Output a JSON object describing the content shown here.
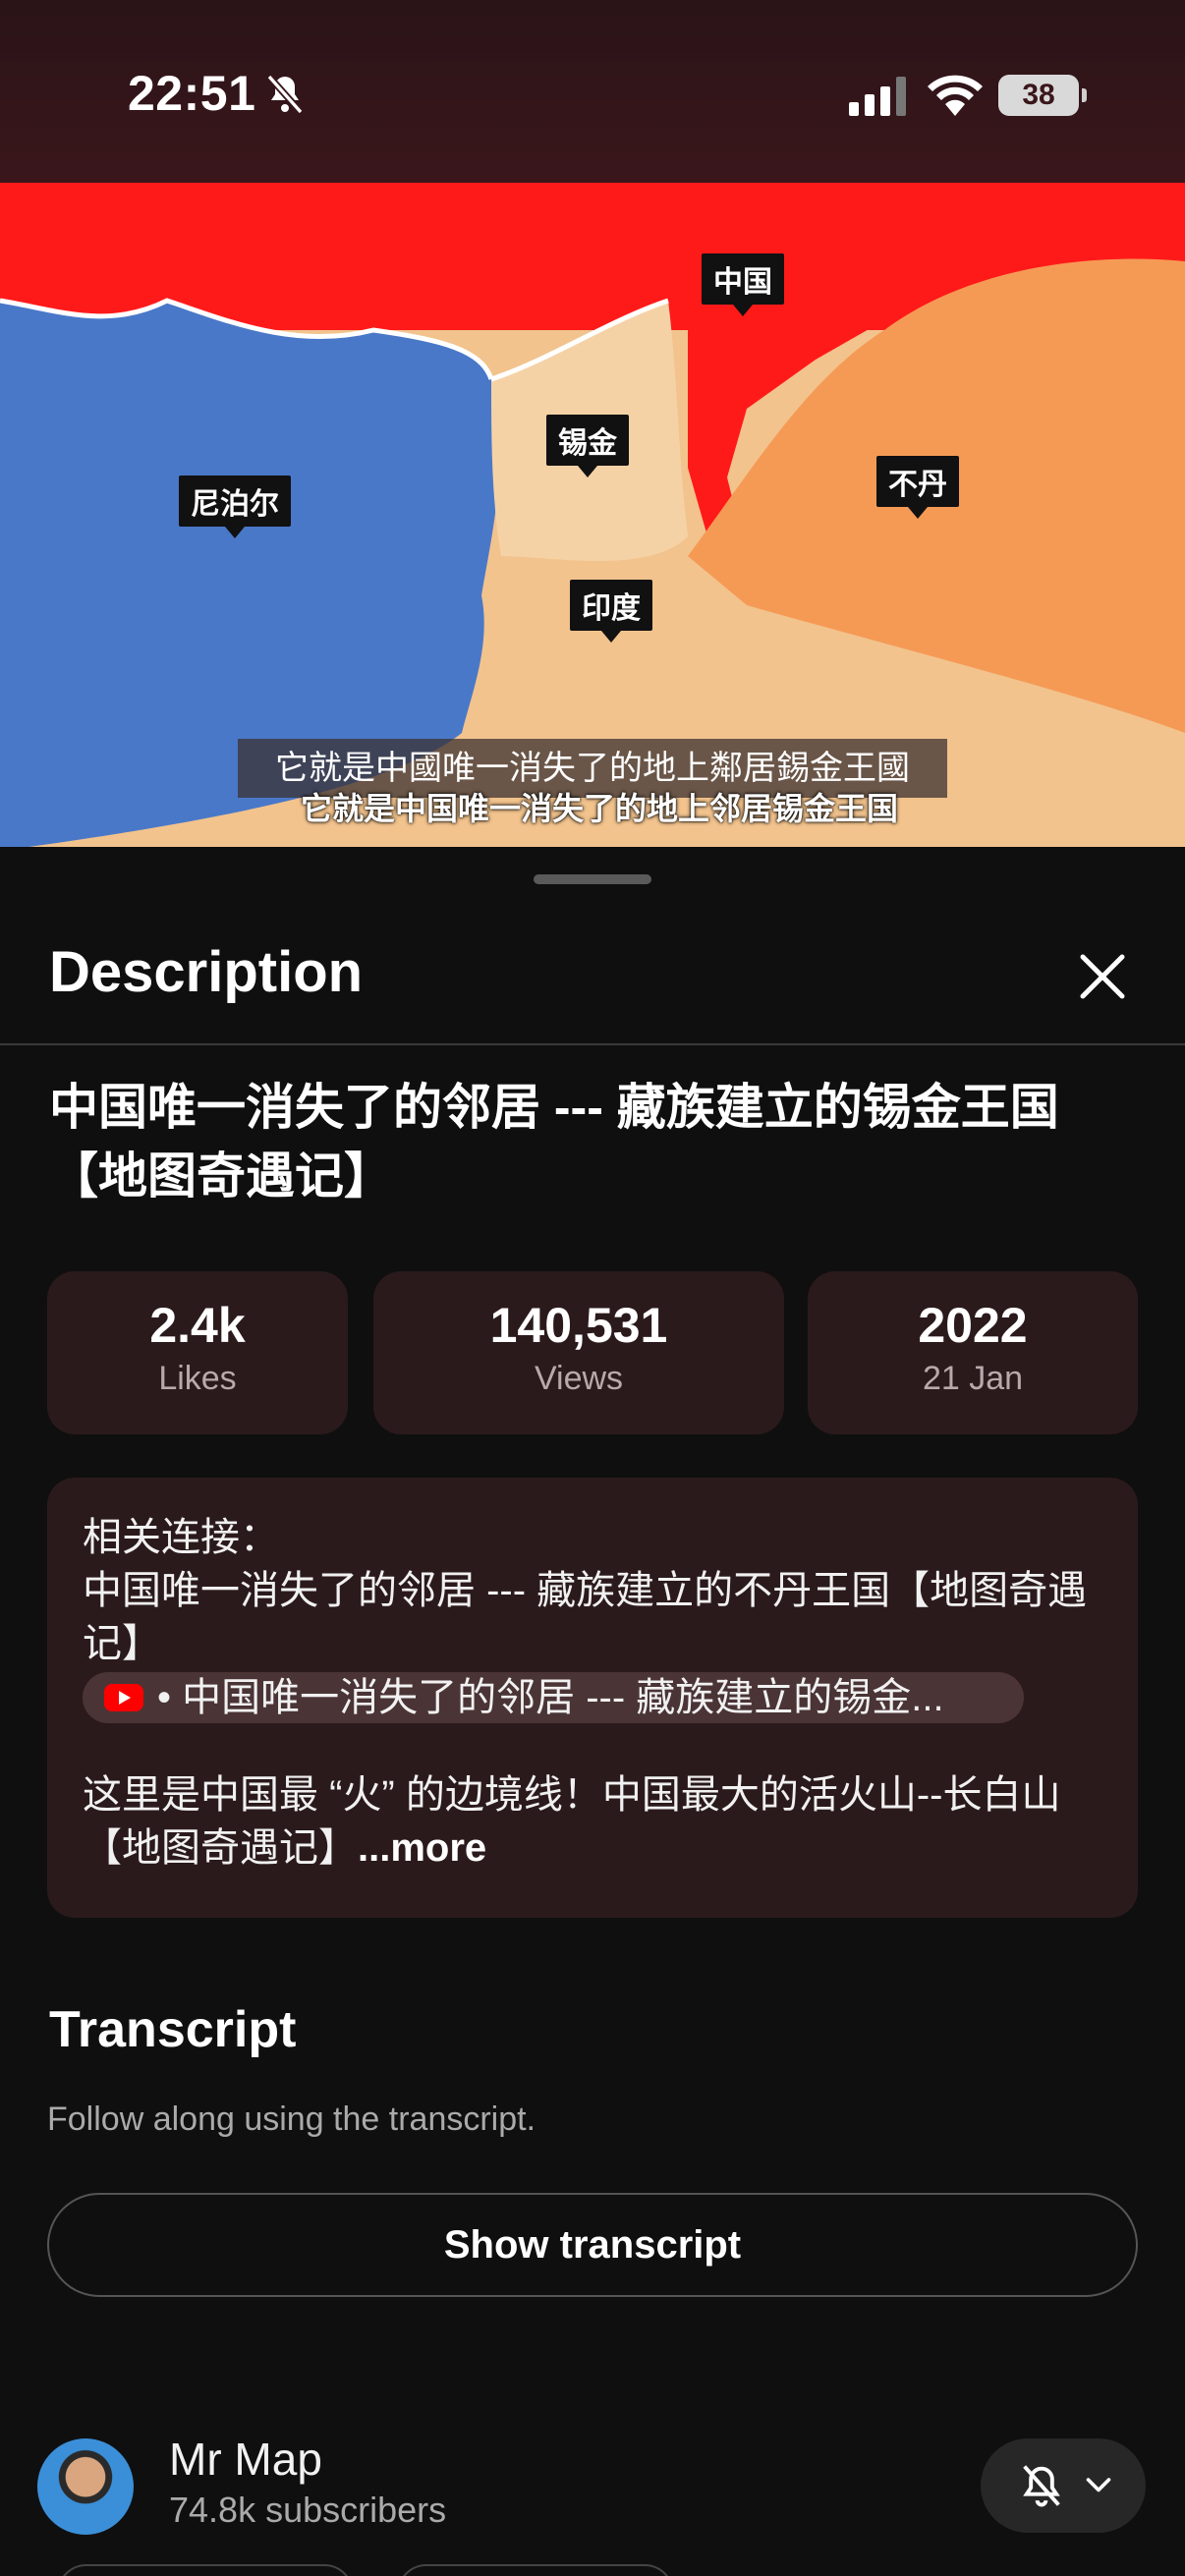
{
  "status_bar": {
    "time": "22:51",
    "battery": "38",
    "icons": [
      "bell-slash-icon",
      "cellular-signal-icon",
      "wifi-icon",
      "battery-icon"
    ]
  },
  "video": {
    "map_labels": [
      "中国",
      "锡金",
      "尼泊尔",
      "不丹",
      "印度"
    ],
    "caption": "它就是中國唯一消失了的地上鄰居錫金王國",
    "burned_subtitle": "它就是中国唯一消失了的地上邻居锡金王国",
    "progress": 0.12
  },
  "sheet": {
    "title": "Description",
    "video_title": "中国唯一消失了的邻居 --- 藏族建立的锡金王国 【地图奇遇记】",
    "stats": [
      {
        "value": "2.4k",
        "label": "Likes"
      },
      {
        "value": "140,531",
        "label": "Views"
      },
      {
        "value": "2022",
        "label": "21 Jan"
      }
    ],
    "description": {
      "line1": "相关连接：",
      "line2": "中国唯一消失了的邻居 --- 藏族建立的不丹王国【地图奇遇记】",
      "chip": "• 中国唯一消失了的邻居 --- 藏族建立的锡金...",
      "line3": "这里是中国最 “火” 的边境线！中国最大的活火山--长白山【地图奇遇记】",
      "more": "...more"
    },
    "transcript": {
      "title": "Transcript",
      "subtitle": "Follow along using the transcript.",
      "button": "Show transcript"
    },
    "channel": {
      "name": "Mr Map",
      "subscribers": "74.8k subscribers"
    }
  },
  "colors": {
    "background": "#0f0f0f",
    "card": "#2b1a1c",
    "accent": "#ff0000",
    "china_red": "#ff1a1a",
    "nepal_blue": "#4a78c8",
    "bhutan_orange": "#f59a55",
    "sikkim_tan": "#f2c38d"
  }
}
